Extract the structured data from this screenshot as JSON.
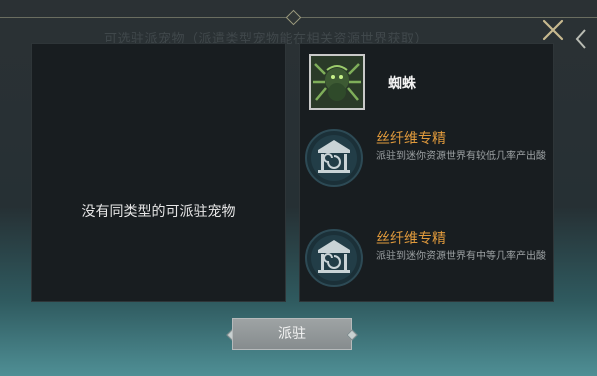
{
  "dialog": {
    "title": "可选驻派宠物（派遣类型宠物能在相关资源世界获取）",
    "close_icon": "close-icon",
    "side_icon": "chevron-left-icon"
  },
  "left_panel": {
    "empty_message": "没有同类型的可派驻宠物"
  },
  "pet": {
    "name": "蜘蛛",
    "portrait_icon": "spider-portrait"
  },
  "skills": [
    {
      "title": "丝纤维专精",
      "desc": "派驻到迷你资源世界有较低几率产出酸",
      "icon": "temple-swirl-icon"
    },
    {
      "title": "丝纤维专精",
      "desc": "派驻到迷你资源世界有中等几率产出酸",
      "icon": "temple-swirl-icon"
    }
  ],
  "footer": {
    "deploy_label": "派驻"
  },
  "colors": {
    "skill_title": "#e09a3c",
    "panel_bg": "#181d20",
    "close_x": "#c7b98f"
  }
}
